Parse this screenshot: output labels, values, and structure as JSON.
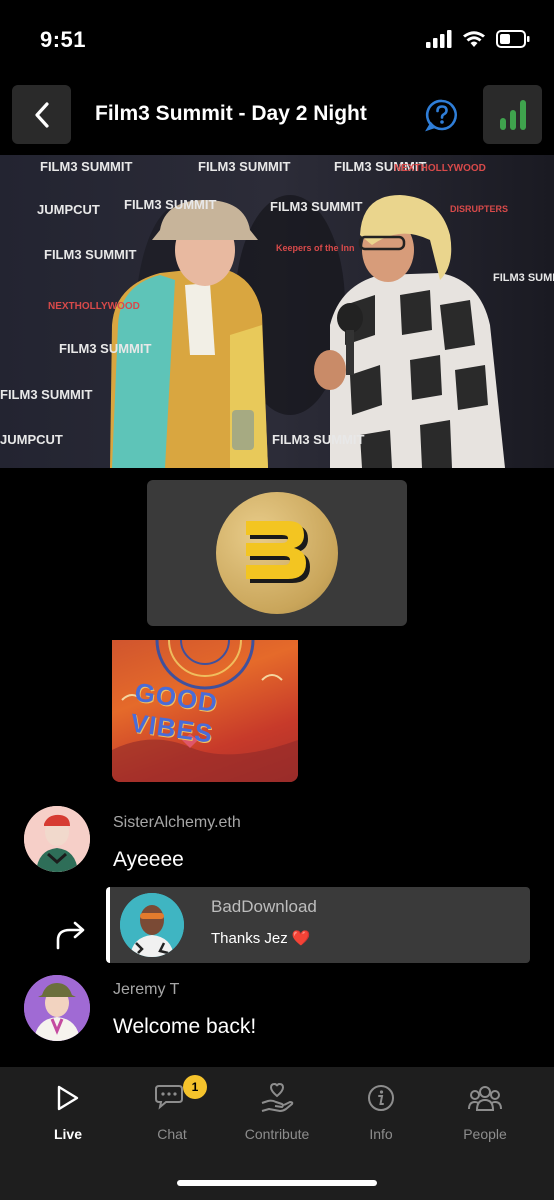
{
  "status_bar": {
    "time": "9:51"
  },
  "header": {
    "title": "Film3 Summit - Day 2 Night"
  },
  "video": {
    "backdrop_logos": [
      "FILM3 SUMMIT",
      "JUMPCUT",
      "NEXTHOLLYWOOD",
      "Keepers of the Inn",
      "DISRUPTERS",
      "B"
    ]
  },
  "messages": [
    {
      "username": "SisterAlchemy.eth",
      "text": "Ayeeee"
    },
    {
      "username": "BadDownload",
      "text": "Thanks Jez ❤️"
    },
    {
      "username": "Jeremy T",
      "text": "Welcome back!"
    }
  ],
  "vibes_image": {
    "text": "GOOD VIBES"
  },
  "nav": {
    "items": [
      {
        "label": "Live",
        "icon": "play-icon",
        "active": true
      },
      {
        "label": "Chat",
        "icon": "chat-icon",
        "badge": "1"
      },
      {
        "label": "Contribute",
        "icon": "contribute-icon"
      },
      {
        "label": "Info",
        "icon": "info-icon"
      },
      {
        "label": "People",
        "icon": "people-icon"
      }
    ]
  },
  "colors": {
    "accent_green": "#3fa34d",
    "help_blue": "#2f7ed8",
    "badge_yellow": "#f5c32c"
  }
}
